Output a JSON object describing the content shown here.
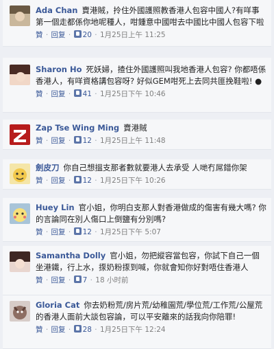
{
  "labels": {
    "like": "贊",
    "reply": "回复",
    "separator": "·"
  },
  "comments": [
    {
      "author": "Ada Chan",
      "text": "賣港賊，拎住外國護照教香港人包容中國人?有咩事第一個走都係你地呢種人，咁鍾意中國咁去中國比中國人包容下啦",
      "likes": "20",
      "time": "1月25日上午 11:25"
    },
    {
      "author": "Sharon Ho",
      "text": "死妖婦，揸住外國護照叫我地香港人包容? 你都唔係香港人，有咩資格講包容呀? 好似GEM咁死上去同共匪挽鞋啦! ●",
      "likes": "41",
      "time": "1月25日下午 10:46"
    },
    {
      "author": "Zap Tse Wing Ming",
      "text": "賣港賊",
      "likes": "12",
      "time": "1月25日上午 11:48"
    },
    {
      "author": "劍皮刀",
      "text": "你自己想搵支那者數就要港人去承受 人哋冇屌錯你架",
      "likes": "12",
      "time": "1月25日下午 10:26"
    },
    {
      "author": "Huey Lin",
      "text": "官小姐，你明白支那人對香港做成的傷害有幾大嗎? 你的言論同在別人傷口上倒鹽有分別嗎?",
      "likes": "12",
      "time": "1月25日下午 5:07"
    },
    {
      "author": "Samantha Dolly",
      "text": "官小姐，勿把縱容當包容，你試下自己一個坐港鐵，行上水，揼奶粉揼到喊，你就會知你好對唔住香港人",
      "likes": "7",
      "time": "18 小时前"
    },
    {
      "author": "Gloria Cat",
      "text": "你去奶粉荒/房片荒/幼稚園荒/學位荒/工作荒/公屋荒的香港人面前大談包容論，可以平安離來的話我向你陪罪!",
      "likes": "28",
      "time": "1月25日下午 12:24"
    }
  ],
  "colors": {
    "link": "#3b5998",
    "background": "#edeff4",
    "card": "#f6f7f9",
    "muted": "#7f7f7f"
  }
}
